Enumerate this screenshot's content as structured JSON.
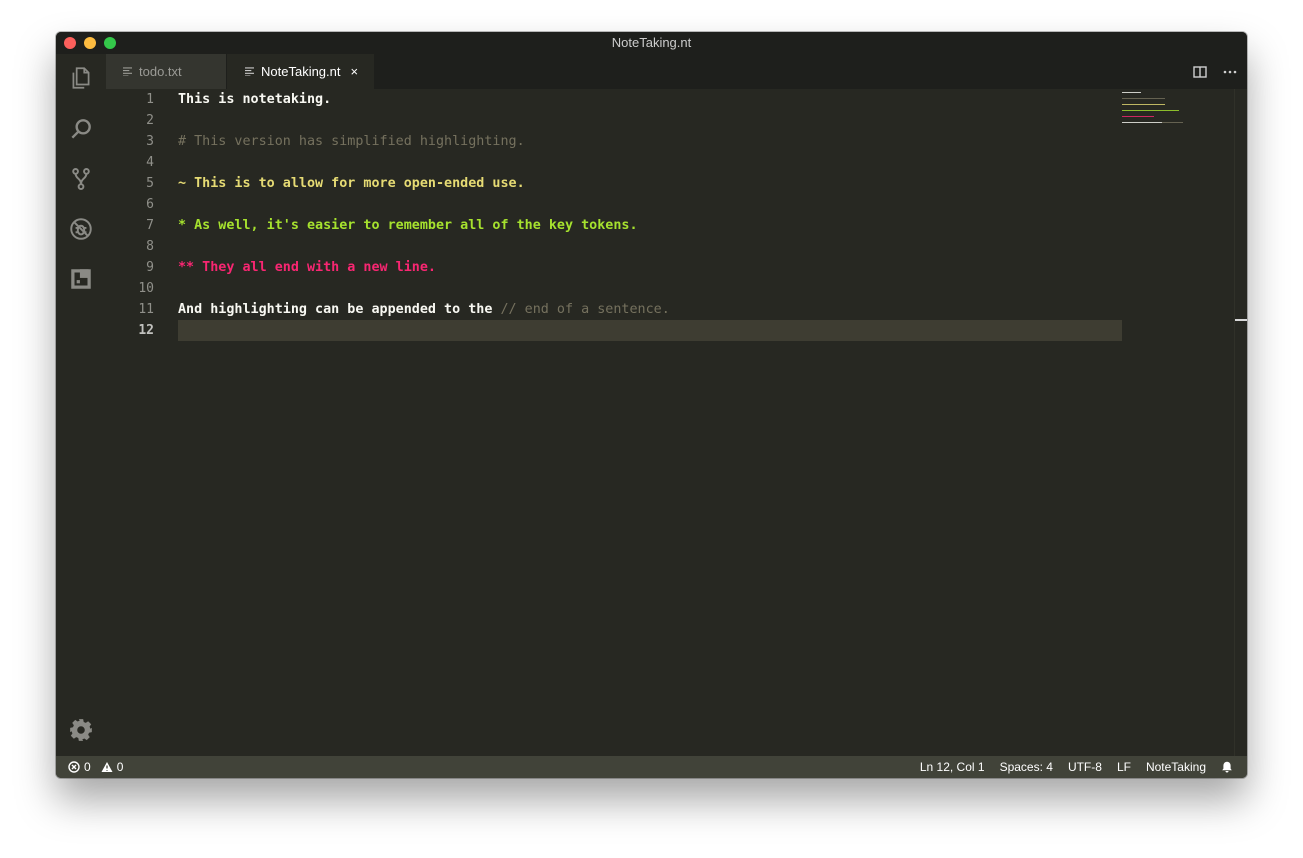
{
  "window": {
    "title": "NoteTaking.nt"
  },
  "tabs": [
    {
      "label": "todo.txt",
      "active": false
    },
    {
      "label": "NoteTaking.nt",
      "active": true,
      "close": "×"
    }
  ],
  "activity_icons": [
    "files-icon",
    "search-icon",
    "source-control-icon",
    "debug-icon",
    "extensions-icon",
    "settings-gear-icon"
  ],
  "editor": {
    "current_line": 12,
    "lines": [
      {
        "n": "1",
        "segments": [
          {
            "text": "This is notetaking.",
            "style": "white"
          }
        ]
      },
      {
        "n": "2",
        "segments": []
      },
      {
        "n": "3",
        "segments": [
          {
            "text": "# This version has simplified highlighting.",
            "style": "comment"
          }
        ]
      },
      {
        "n": "4",
        "segments": []
      },
      {
        "n": "5",
        "segments": [
          {
            "text": "~ This is to allow for more open-ended use.",
            "style": "yellow"
          }
        ]
      },
      {
        "n": "6",
        "segments": []
      },
      {
        "n": "7",
        "segments": [
          {
            "text": "* As well, it's easier to remember all of the key tokens.",
            "style": "green"
          }
        ]
      },
      {
        "n": "8",
        "segments": []
      },
      {
        "n": "9",
        "segments": [
          {
            "text": "** They all end with a new line.",
            "style": "red"
          }
        ]
      },
      {
        "n": "10",
        "segments": []
      },
      {
        "n": "11",
        "segments": [
          {
            "text": "And highlighting can be appended to the ",
            "style": "white"
          },
          {
            "text": "// end of a sentence.",
            "style": "comment"
          }
        ]
      },
      {
        "n": "12",
        "segments": []
      }
    ]
  },
  "status": {
    "errors": "0",
    "warnings": "0",
    "position": "Ln 12, Col 1",
    "spaces": "Spaces: 4",
    "encoding": "UTF-8",
    "eol": "LF",
    "language": "NoteTaking"
  },
  "colors": {
    "background": "#272822",
    "comment": "#75715e",
    "yellow": "#e6db74",
    "green": "#a6e22e",
    "red": "#f92672",
    "statusbar": "#414339"
  }
}
